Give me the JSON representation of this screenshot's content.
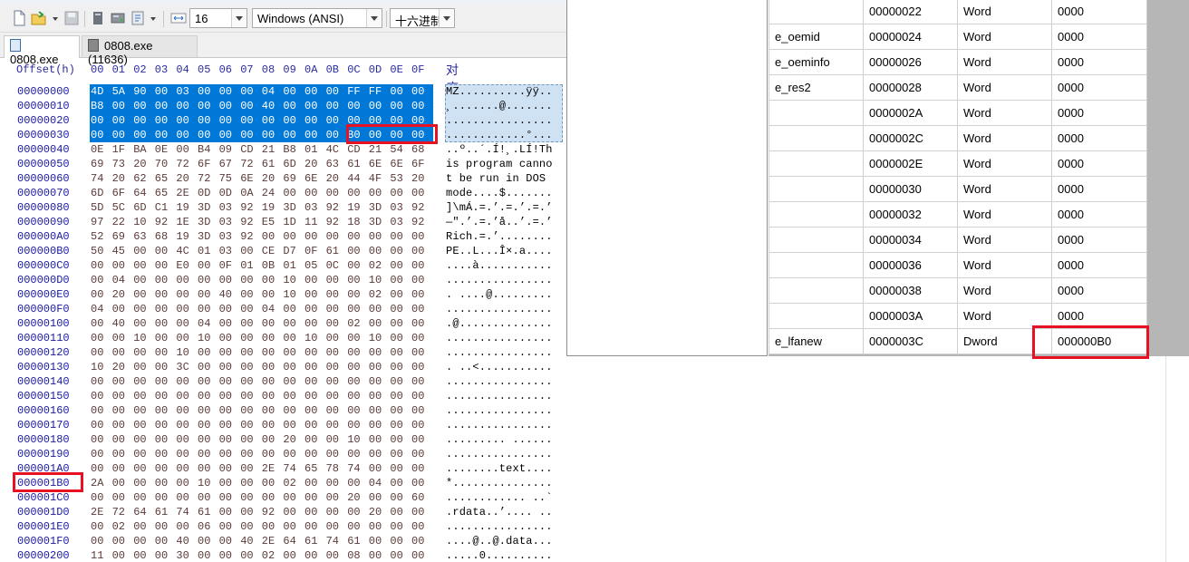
{
  "toolbar": {
    "bytes_per_row": "16",
    "encoding": "Windows (ANSI)",
    "number_base": "十六进制"
  },
  "tabs": [
    {
      "label": "0808.exe"
    },
    {
      "label": "0808.exe (11636)"
    }
  ],
  "hex_view": {
    "offset_header": "Offset(h)",
    "column_headers": [
      "00",
      "01",
      "02",
      "03",
      "04",
      "05",
      "06",
      "07",
      "08",
      "09",
      "0A",
      "0B",
      "0C",
      "0D",
      "0E",
      "0F"
    ],
    "text_header": "对应文本",
    "rows": [
      {
        "offset": "00000000",
        "bytes": "4D 5A 90 00 03 00 00 00 04 00 00 00 FF FF 00 00",
        "text": "MZ..........ÿÿ.."
      },
      {
        "offset": "00000010",
        "bytes": "B8 00 00 00 00 00 00 00 40 00 00 00 00 00 00 00",
        "text": "¸.......@......."
      },
      {
        "offset": "00000020",
        "bytes": "00 00 00 00 00 00 00 00 00 00 00 00 00 00 00 00",
        "text": "................"
      },
      {
        "offset": "00000030",
        "bytes": "00 00 00 00 00 00 00 00 00 00 00 00 B0 00 00 00",
        "text": "............°..."
      },
      {
        "offset": "00000040",
        "bytes": "0E 1F BA 0E 00 B4 09 CD 21 B8 01 4C CD 21 54 68",
        "text": "..º..´.Í!¸.LÍ!Th"
      },
      {
        "offset": "00000050",
        "bytes": "69 73 20 70 72 6F 67 72 61 6D 20 63 61 6E 6E 6F",
        "text": "is program canno"
      },
      {
        "offset": "00000060",
        "bytes": "74 20 62 65 20 72 75 6E 20 69 6E 20 44 4F 53 20",
        "text": "t be run in DOS "
      },
      {
        "offset": "00000070",
        "bytes": "6D 6F 64 65 2E 0D 0D 0A 24 00 00 00 00 00 00 00",
        "text": "mode....$......."
      },
      {
        "offset": "00000080",
        "bytes": "5D 5C 6D C1 19 3D 03 92 19 3D 03 92 19 3D 03 92",
        "text": "]\\mÁ.=.’.=.’.=.’"
      },
      {
        "offset": "00000090",
        "bytes": "97 22 10 92 1E 3D 03 92 E5 1D 11 92 18 3D 03 92",
        "text": "—\".’.=.’å..’.=.’"
      },
      {
        "offset": "000000A0",
        "bytes": "52 69 63 68 19 3D 03 92 00 00 00 00 00 00 00 00",
        "text": "Rich.=.’........"
      },
      {
        "offset": "000000B0",
        "bytes": "50 45 00 00 4C 01 03 00 CE D7 0F 61 00 00 00 00",
        "text": "PE..L...Î×.a...."
      },
      {
        "offset": "000000C0",
        "bytes": "00 00 00 00 E0 00 0F 01 0B 01 05 0C 00 02 00 00",
        "text": "....à..........."
      },
      {
        "offset": "000000D0",
        "bytes": "00 04 00 00 00 00 00 00 00 10 00 00 00 10 00 00",
        "text": "................"
      },
      {
        "offset": "000000E0",
        "bytes": "00 20 00 00 00 00 40 00 00 10 00 00 00 02 00 00",
        "text": ". ....@........."
      },
      {
        "offset": "000000F0",
        "bytes": "04 00 00 00 00 00 00 00 04 00 00 00 00 00 00 00",
        "text": "................"
      },
      {
        "offset": "00000100",
        "bytes": "00 40 00 00 00 04 00 00 00 00 00 00 02 00 00 00",
        "text": ".@.............."
      },
      {
        "offset": "00000110",
        "bytes": "00 00 10 00 00 10 00 00 00 00 10 00 00 10 00 00",
        "text": "................"
      },
      {
        "offset": "00000120",
        "bytes": "00 00 00 00 10 00 00 00 00 00 00 00 00 00 00 00",
        "text": "................"
      },
      {
        "offset": "00000130",
        "bytes": "10 20 00 00 3C 00 00 00 00 00 00 00 00 00 00 00",
        "text": ". ..<..........."
      },
      {
        "offset": "00000140",
        "bytes": "00 00 00 00 00 00 00 00 00 00 00 00 00 00 00 00",
        "text": "................"
      },
      {
        "offset": "00000150",
        "bytes": "00 00 00 00 00 00 00 00 00 00 00 00 00 00 00 00",
        "text": "................"
      },
      {
        "offset": "00000160",
        "bytes": "00 00 00 00 00 00 00 00 00 00 00 00 00 00 00 00",
        "text": "................"
      },
      {
        "offset": "00000170",
        "bytes": "00 00 00 00 00 00 00 00 00 00 00 00 00 00 00 00",
        "text": "................"
      },
      {
        "offset": "00000180",
        "bytes": "00 00 00 00 00 00 00 00 00 20 00 00 10 00 00 00",
        "text": "......... ......"
      },
      {
        "offset": "00000190",
        "bytes": "00 00 00 00 00 00 00 00 00 00 00 00 00 00 00 00",
        "text": "................"
      },
      {
        "offset": "000001A0",
        "bytes": "00 00 00 00 00 00 00 00 2E 74 65 78 74 00 00 00",
        "text": "........text...."
      },
      {
        "offset": "000001B0",
        "bytes": "2A 00 00 00 00 10 00 00 00 02 00 00 00 04 00 00",
        "text": "*..............."
      },
      {
        "offset": "000001C0",
        "bytes": "00 00 00 00 00 00 00 00 00 00 00 00 20 00 00 60",
        "text": "............ ..`"
      },
      {
        "offset": "000001D0",
        "bytes": "2E 72 64 61 74 61 00 00 92 00 00 00 00 20 00 00",
        "text": ".rdata..’.... .."
      },
      {
        "offset": "000001E0",
        "bytes": "00 02 00 00 00 06 00 00 00 00 00 00 00 00 00 00",
        "text": "................"
      },
      {
        "offset": "000001F0",
        "bytes": "00 00 00 00 40 00 00 40 2E 64 61 74 61 00 00 00",
        "text": "....@..@.data..."
      },
      {
        "offset": "00000200",
        "bytes": "11 00 00 00 30 00 00 00 02 00 00 00 08 00 00 00",
        "text": ".....0.........."
      }
    ]
  },
  "header_table": {
    "rows": [
      {
        "name": "",
        "offset": "00000022",
        "type": "Word",
        "value": "0000"
      },
      {
        "name": "e_oemid",
        "offset": "00000024",
        "type": "Word",
        "value": "0000"
      },
      {
        "name": "e_oeminfo",
        "offset": "00000026",
        "type": "Word",
        "value": "0000"
      },
      {
        "name": "e_res2",
        "offset": "00000028",
        "type": "Word",
        "value": "0000"
      },
      {
        "name": "",
        "offset": "0000002A",
        "type": "Word",
        "value": "0000"
      },
      {
        "name": "",
        "offset": "0000002C",
        "type": "Word",
        "value": "0000"
      },
      {
        "name": "",
        "offset": "0000002E",
        "type": "Word",
        "value": "0000"
      },
      {
        "name": "",
        "offset": "00000030",
        "type": "Word",
        "value": "0000"
      },
      {
        "name": "",
        "offset": "00000032",
        "type": "Word",
        "value": "0000"
      },
      {
        "name": "",
        "offset": "00000034",
        "type": "Word",
        "value": "0000"
      },
      {
        "name": "",
        "offset": "00000036",
        "type": "Word",
        "value": "0000"
      },
      {
        "name": "",
        "offset": "00000038",
        "type": "Word",
        "value": "0000"
      },
      {
        "name": "",
        "offset": "0000003A",
        "type": "Word",
        "value": "0000"
      },
      {
        "name": "e_lfanew",
        "offset": "0000003C",
        "type": "Dword",
        "value": "000000B0"
      }
    ]
  },
  "colors": {
    "selection": "#0078d7",
    "highlight_box": "#e81123",
    "offset_text": "#1a1aa0"
  }
}
